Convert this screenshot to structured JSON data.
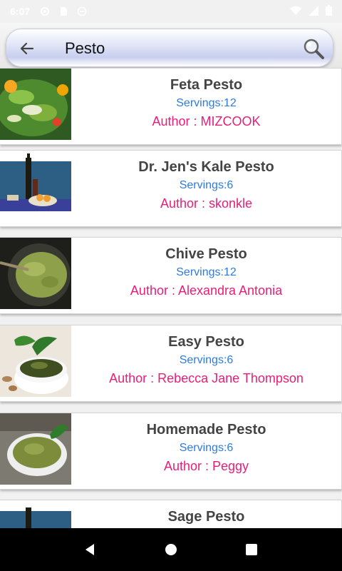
{
  "status_bar": {
    "time": "6:07"
  },
  "search": {
    "query": "Pesto"
  },
  "recipes": [
    {
      "title": "Feta Pesto",
      "servings": "Servings:12",
      "author": "Author : MIZCOOK"
    },
    {
      "title": "Dr. Jen's Kale Pesto",
      "servings": "Servings:6",
      "author": "Author : skonkle"
    },
    {
      "title": "Chive Pesto",
      "servings": "Servings:12",
      "author": "Author : Alexandra Antonia"
    },
    {
      "title": "Easy Pesto",
      "servings": "Servings:6",
      "author": "Author : Rebecca Jane Thompson"
    },
    {
      "title": "Homemade Pesto",
      "servings": "Servings:6",
      "author": "Author : Peggy"
    },
    {
      "title": "Sage Pesto",
      "servings": "",
      "author": ""
    }
  ],
  "icons": {
    "back": "arrow-back-icon",
    "search": "magnifier-icon",
    "nav_back": "triangle-back-icon",
    "nav_home": "circle-home-icon",
    "nav_recents": "square-recents-icon"
  },
  "colors": {
    "title": "#444444",
    "servings": "#2b7be4",
    "author": "#e91e78",
    "nav_bar": "#000000"
  }
}
